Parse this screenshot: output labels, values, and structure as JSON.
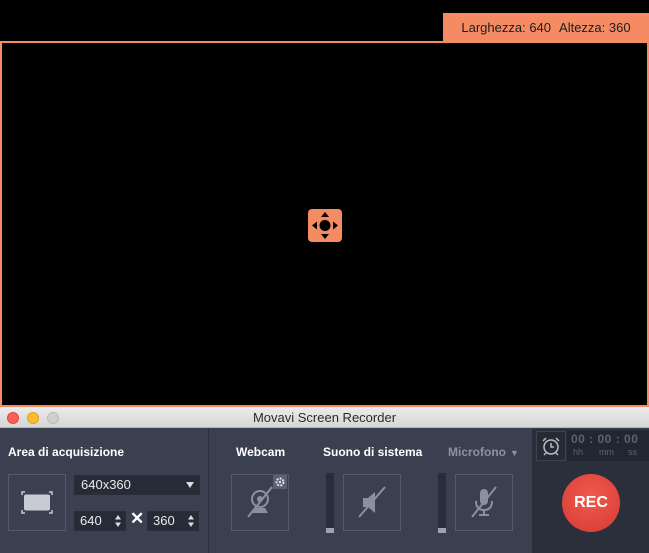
{
  "capture": {
    "width_label": "Larghezza:",
    "width_value": "640",
    "height_label": "Altezza:",
    "height_value": "360",
    "move_icon": "move-arrows-icon"
  },
  "window": {
    "title": "Movavi Screen Recorder"
  },
  "capture_area": {
    "label": "Area di acquisizione",
    "preset": "640x360",
    "width": "640",
    "height": "360",
    "times_symbol": "✕"
  },
  "webcam": {
    "label": "Webcam",
    "icon": "webcam-off-icon",
    "settings_icon": "gear-icon"
  },
  "system_audio": {
    "label": "Suono di sistema",
    "icon": "speaker-muted-icon",
    "level": 0.08
  },
  "microphone": {
    "label": "Microfono",
    "icon": "microphone-off-icon",
    "level": 0.08
  },
  "timer": {
    "icon": "alarm-clock-icon",
    "digits": "00 : 00 : 00",
    "units": [
      "hh",
      "mm",
      "ss"
    ]
  },
  "rec_button": {
    "label": "REC"
  },
  "colors": {
    "accent": "#f58b62",
    "panel": "#3b4051",
    "rec": "#e2463c"
  }
}
